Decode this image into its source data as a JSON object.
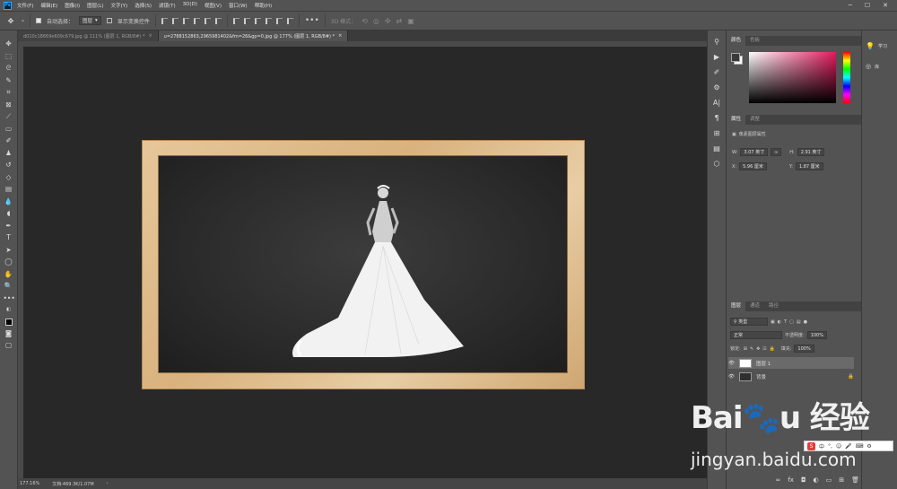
{
  "menubar": {
    "logo": "Ps",
    "items": [
      "文件(F)",
      "编辑(E)",
      "图像(I)",
      "图层(L)",
      "文字(Y)",
      "选择(S)",
      "滤镜(T)",
      "3D(D)",
      "视图(V)",
      "窗口(W)",
      "帮助(H)"
    ],
    "window_controls": [
      "─",
      "☐",
      "✕"
    ]
  },
  "options": {
    "auto_select_label": "自动选择：",
    "auto_select_value": "图层",
    "show_transform_label": "显示变换控件",
    "mode_label": "3D 模式："
  },
  "tabs": [
    {
      "label": "d010c18669e609c679.jpg @ 111% (图层 1, RGB/8#) *",
      "active": false,
      "close": "×"
    },
    {
      "label": "u=2788152863,2965981402&fm=26&gp=0.jpg @ 177% (图层 1, RGB/8#) *",
      "active": true,
      "close": "×"
    }
  ],
  "status": {
    "zoom": "177.16%",
    "doc_info": "文档:469.3K/1.07M",
    "arrow": "›"
  },
  "color_panel": {
    "tabs": [
      "颜色",
      "色板"
    ],
    "fg_color": "#3a3a3a",
    "bg_color": "#ffffff",
    "accent": "#e01a5c"
  },
  "properties": {
    "tabs": [
      "属性",
      "调整"
    ],
    "title": "像素图层属性",
    "w_label": "W:",
    "w_value": "3.07 英寸",
    "h_label": "H:",
    "h_value": "2.91 英寸",
    "link_icon": "∞",
    "x_label": "X:",
    "x_value": "5.96 厘米",
    "y_label": "Y:",
    "y_value": "1.87 厘米"
  },
  "layers": {
    "tabs": [
      "图层",
      "通道",
      "路径"
    ],
    "filter_label": "类型",
    "blend_mode": "正常",
    "opacity_label": "不透明度:",
    "opacity_value": "100%",
    "lock_label": "锁定:",
    "fill_label": "填充:",
    "fill_value": "100%",
    "items": [
      {
        "name": "图层 1",
        "selected": true
      },
      {
        "name": "背景",
        "locked": true
      }
    ]
  },
  "farright": {
    "learn_label": "学习",
    "library_label": "库"
  },
  "watermark": {
    "logo": "Bai🐾u 经验",
    "url": "jingyan.baidu.com"
  },
  "ime": {
    "s_icon": "S",
    "label": "中"
  }
}
